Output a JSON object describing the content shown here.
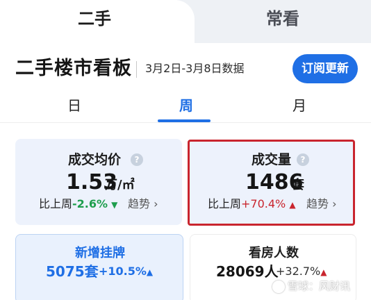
{
  "top_tabs": {
    "active": "二手",
    "inactive": "常看"
  },
  "header": {
    "title": "二手楼市看板",
    "date_range": "3月2日-3月8日数据",
    "subscribe_label": "订阅更新"
  },
  "period_tabs": {
    "day": "日",
    "week": "周",
    "month": "月",
    "selected": "周"
  },
  "cards": {
    "avg_price": {
      "label": "成交均价",
      "value": "1.53",
      "unit": "万/㎡",
      "compare_prefix": "比上周",
      "change": "-2.6%",
      "trend_label": "趋势"
    },
    "volume": {
      "label": "成交量",
      "value": "1486",
      "unit": "套",
      "compare_prefix": "比上周",
      "change": "+70.4%",
      "trend_label": "趋势"
    },
    "new_listings": {
      "label": "新增挂牌",
      "value": "5075套",
      "change": "+10.5%"
    },
    "viewers": {
      "label": "看房人数",
      "value": "28069人",
      "change": "+32.7%"
    }
  },
  "icons": {
    "help": "?",
    "triangle_down": "▼",
    "triangle_up": "▲",
    "chevron": "›"
  },
  "watermark": "雪球：风财讯",
  "colors": {
    "accent_blue": "#1f6fe5",
    "up_red": "#c9252e",
    "down_green": "#1e9e4d",
    "card_bg": "#edf2fc"
  }
}
